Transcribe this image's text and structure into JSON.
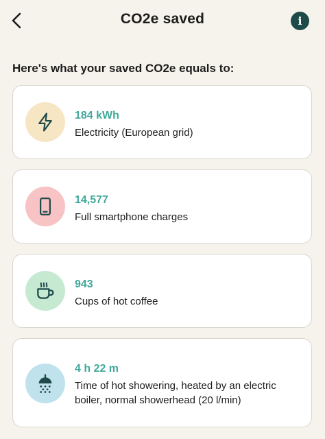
{
  "header": {
    "title": "CO2e saved",
    "back_icon": "chevron-left-icon",
    "info_icon": "info-icon",
    "info_glyph": "i"
  },
  "section": {
    "heading": "Here's what your saved CO2e equals to:"
  },
  "colors": {
    "accent_value": "#3fa99a",
    "info_button": "#1f4a4a",
    "background": "#f6f3ec"
  },
  "cards": [
    {
      "value": "184 kWh",
      "label": "Electricity (European grid)",
      "icon": "lightning-bolt-icon",
      "icon_bg": "#f7e6c4"
    },
    {
      "value": "14,577",
      "label": "Full smartphone charges",
      "icon": "smartphone-icon",
      "icon_bg": "#f7c3c4"
    },
    {
      "value": "943",
      "label": "Cups of hot coffee",
      "icon": "coffee-cup-icon",
      "icon_bg": "#c6ead1"
    },
    {
      "value": "4 h 22 m",
      "label": "Time of hot showering, heated by an electric boiler, normal showerhead (20 l/min)",
      "icon": "shower-icon",
      "icon_bg": "#bfe2ec"
    }
  ]
}
